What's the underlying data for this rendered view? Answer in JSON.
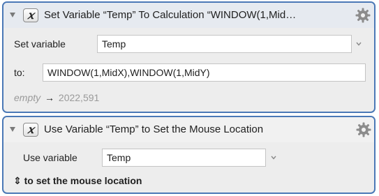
{
  "actions": [
    {
      "title": "Set Variable “Temp” To Calculation “WINDOW(1,Mid…",
      "icon": "x-variable-icon",
      "variable_label": "Set variable",
      "variable_value": "Temp",
      "to_label": "to:",
      "to_value": "WINDOW(1,MidX),WINDOW(1,MidY)",
      "result_prefix": "empty",
      "result_arrow": "→",
      "result_value": "2022,591"
    },
    {
      "title": "Use Variable “Temp” to Set the Mouse Location",
      "icon": "x-variable-icon",
      "variable_label": "Use variable",
      "variable_value": "Temp",
      "option_glyph": "⇕",
      "option_label": "to set the mouse location"
    }
  ],
  "colors": {
    "selection_border": "#4a78b6",
    "panel_background": "#ededed"
  }
}
